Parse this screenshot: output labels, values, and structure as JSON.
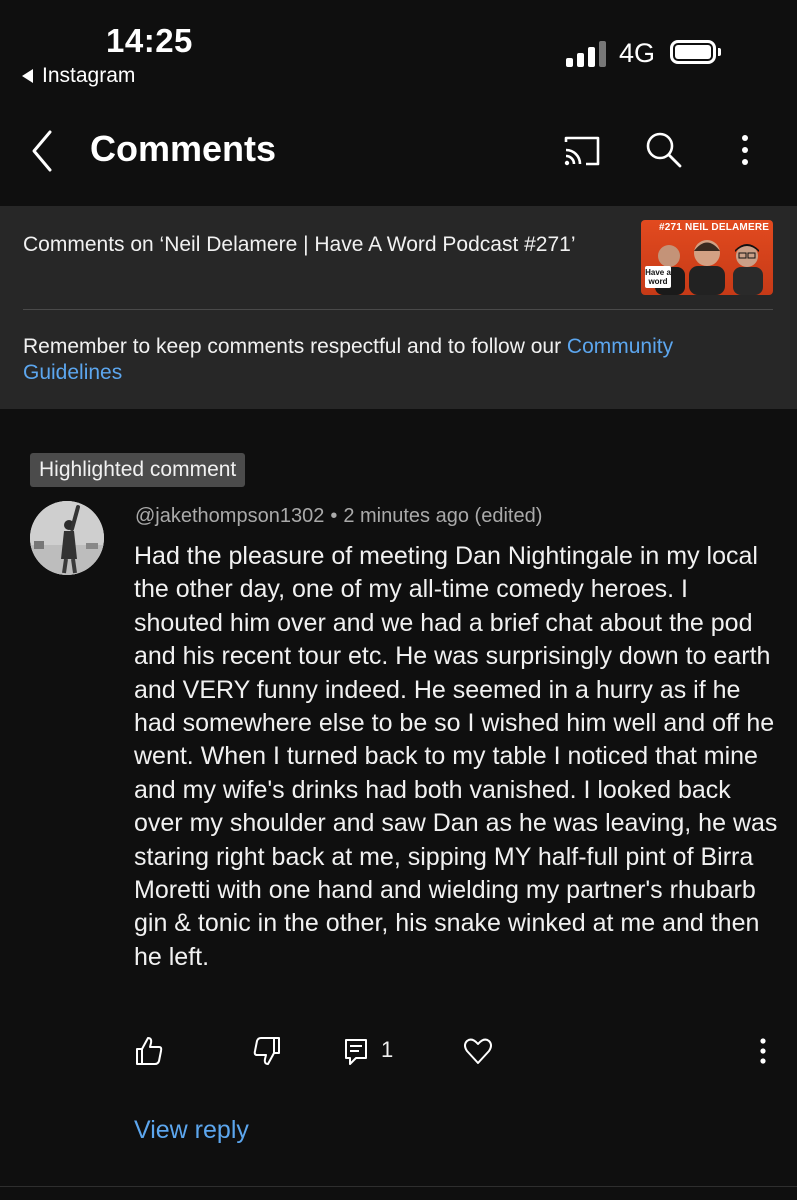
{
  "status_bar": {
    "time": "14:25",
    "back_app": "Instagram",
    "network": "4G"
  },
  "header": {
    "title": "Comments",
    "icons": [
      "back-arrow-icon",
      "cast-icon",
      "search-icon",
      "more-vertical-icon"
    ]
  },
  "info": {
    "video_title": "Comments on ‘Neil Delamere | Have A Word Podcast #271’",
    "thumbnail_caption": "#271 NEIL DELAMERE",
    "thumbnail_logo": "Have a word",
    "guidelines_text": "Remember to keep comments respectful and to follow our ",
    "guidelines_link": "Community Guidelines"
  },
  "comment": {
    "badge": "Highlighted comment",
    "author": "@jakethompson1302",
    "separator": "•",
    "time": "2 minutes ago (edited)",
    "body": "Had the pleasure of meeting Dan Nightingale in my local the other day, one of my all-time comedy heroes. I shouted him over and we had a brief chat about the pod and his recent tour etc. He was surprisingly down to earth and VERY funny indeed. He seemed in a hurry as if he had somewhere else to be so I wished him well and off he went. When I turned back to my table I noticed that mine and my wife's drinks had both vanished. I looked back over my shoulder and saw Dan as he was leaving, he was staring right back at me, sipping MY half-full pint of Birra Moretti with one hand and wielding my partner's rhubarb gin & tonic in the other, his snake winked at me and then he left.",
    "reply_count": "1",
    "view_reply": "View reply",
    "action_icons": [
      "thumbs-up-icon",
      "thumbs-down-icon",
      "reply-icon",
      "heart-icon",
      "more-vertical-icon"
    ]
  },
  "colors": {
    "background": "#0f0f0f",
    "panel": "#272727",
    "link": "#5ca6ee",
    "badge": "#4b4b4b",
    "secondary_text": "#aaaaaa"
  }
}
